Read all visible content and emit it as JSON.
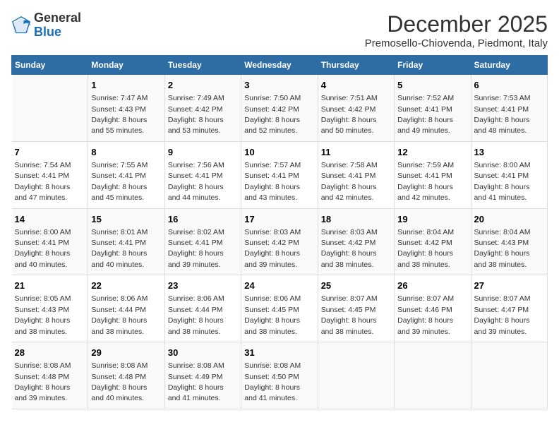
{
  "logo": {
    "general": "General",
    "blue": "Blue"
  },
  "title": "December 2025",
  "location": "Premosello-Chiovenda, Piedmont, Italy",
  "days_of_week": [
    "Sunday",
    "Monday",
    "Tuesday",
    "Wednesday",
    "Thursday",
    "Friday",
    "Saturday"
  ],
  "weeks": [
    [
      {
        "day": "",
        "info": ""
      },
      {
        "day": "1",
        "info": "Sunrise: 7:47 AM\nSunset: 4:43 PM\nDaylight: 8 hours\nand 55 minutes."
      },
      {
        "day": "2",
        "info": "Sunrise: 7:49 AM\nSunset: 4:42 PM\nDaylight: 8 hours\nand 53 minutes."
      },
      {
        "day": "3",
        "info": "Sunrise: 7:50 AM\nSunset: 4:42 PM\nDaylight: 8 hours\nand 52 minutes."
      },
      {
        "day": "4",
        "info": "Sunrise: 7:51 AM\nSunset: 4:42 PM\nDaylight: 8 hours\nand 50 minutes."
      },
      {
        "day": "5",
        "info": "Sunrise: 7:52 AM\nSunset: 4:41 PM\nDaylight: 8 hours\nand 49 minutes."
      },
      {
        "day": "6",
        "info": "Sunrise: 7:53 AM\nSunset: 4:41 PM\nDaylight: 8 hours\nand 48 minutes."
      }
    ],
    [
      {
        "day": "7",
        "info": "Sunrise: 7:54 AM\nSunset: 4:41 PM\nDaylight: 8 hours\nand 47 minutes."
      },
      {
        "day": "8",
        "info": "Sunrise: 7:55 AM\nSunset: 4:41 PM\nDaylight: 8 hours\nand 45 minutes."
      },
      {
        "day": "9",
        "info": "Sunrise: 7:56 AM\nSunset: 4:41 PM\nDaylight: 8 hours\nand 44 minutes."
      },
      {
        "day": "10",
        "info": "Sunrise: 7:57 AM\nSunset: 4:41 PM\nDaylight: 8 hours\nand 43 minutes."
      },
      {
        "day": "11",
        "info": "Sunrise: 7:58 AM\nSunset: 4:41 PM\nDaylight: 8 hours\nand 42 minutes."
      },
      {
        "day": "12",
        "info": "Sunrise: 7:59 AM\nSunset: 4:41 PM\nDaylight: 8 hours\nand 42 minutes."
      },
      {
        "day": "13",
        "info": "Sunrise: 8:00 AM\nSunset: 4:41 PM\nDaylight: 8 hours\nand 41 minutes."
      }
    ],
    [
      {
        "day": "14",
        "info": "Sunrise: 8:00 AM\nSunset: 4:41 PM\nDaylight: 8 hours\nand 40 minutes."
      },
      {
        "day": "15",
        "info": "Sunrise: 8:01 AM\nSunset: 4:41 PM\nDaylight: 8 hours\nand 40 minutes."
      },
      {
        "day": "16",
        "info": "Sunrise: 8:02 AM\nSunset: 4:41 PM\nDaylight: 8 hours\nand 39 minutes."
      },
      {
        "day": "17",
        "info": "Sunrise: 8:03 AM\nSunset: 4:42 PM\nDaylight: 8 hours\nand 39 minutes."
      },
      {
        "day": "18",
        "info": "Sunrise: 8:03 AM\nSunset: 4:42 PM\nDaylight: 8 hours\nand 38 minutes."
      },
      {
        "day": "19",
        "info": "Sunrise: 8:04 AM\nSunset: 4:42 PM\nDaylight: 8 hours\nand 38 minutes."
      },
      {
        "day": "20",
        "info": "Sunrise: 8:04 AM\nSunset: 4:43 PM\nDaylight: 8 hours\nand 38 minutes."
      }
    ],
    [
      {
        "day": "21",
        "info": "Sunrise: 8:05 AM\nSunset: 4:43 PM\nDaylight: 8 hours\nand 38 minutes."
      },
      {
        "day": "22",
        "info": "Sunrise: 8:06 AM\nSunset: 4:44 PM\nDaylight: 8 hours\nand 38 minutes."
      },
      {
        "day": "23",
        "info": "Sunrise: 8:06 AM\nSunset: 4:44 PM\nDaylight: 8 hours\nand 38 minutes."
      },
      {
        "day": "24",
        "info": "Sunrise: 8:06 AM\nSunset: 4:45 PM\nDaylight: 8 hours\nand 38 minutes."
      },
      {
        "day": "25",
        "info": "Sunrise: 8:07 AM\nSunset: 4:45 PM\nDaylight: 8 hours\nand 38 minutes."
      },
      {
        "day": "26",
        "info": "Sunrise: 8:07 AM\nSunset: 4:46 PM\nDaylight: 8 hours\nand 39 minutes."
      },
      {
        "day": "27",
        "info": "Sunrise: 8:07 AM\nSunset: 4:47 PM\nDaylight: 8 hours\nand 39 minutes."
      }
    ],
    [
      {
        "day": "28",
        "info": "Sunrise: 8:08 AM\nSunset: 4:48 PM\nDaylight: 8 hours\nand 39 minutes."
      },
      {
        "day": "29",
        "info": "Sunrise: 8:08 AM\nSunset: 4:48 PM\nDaylight: 8 hours\nand 40 minutes."
      },
      {
        "day": "30",
        "info": "Sunrise: 8:08 AM\nSunset: 4:49 PM\nDaylight: 8 hours\nand 41 minutes."
      },
      {
        "day": "31",
        "info": "Sunrise: 8:08 AM\nSunset: 4:50 PM\nDaylight: 8 hours\nand 41 minutes."
      },
      {
        "day": "",
        "info": ""
      },
      {
        "day": "",
        "info": ""
      },
      {
        "day": "",
        "info": ""
      }
    ]
  ]
}
